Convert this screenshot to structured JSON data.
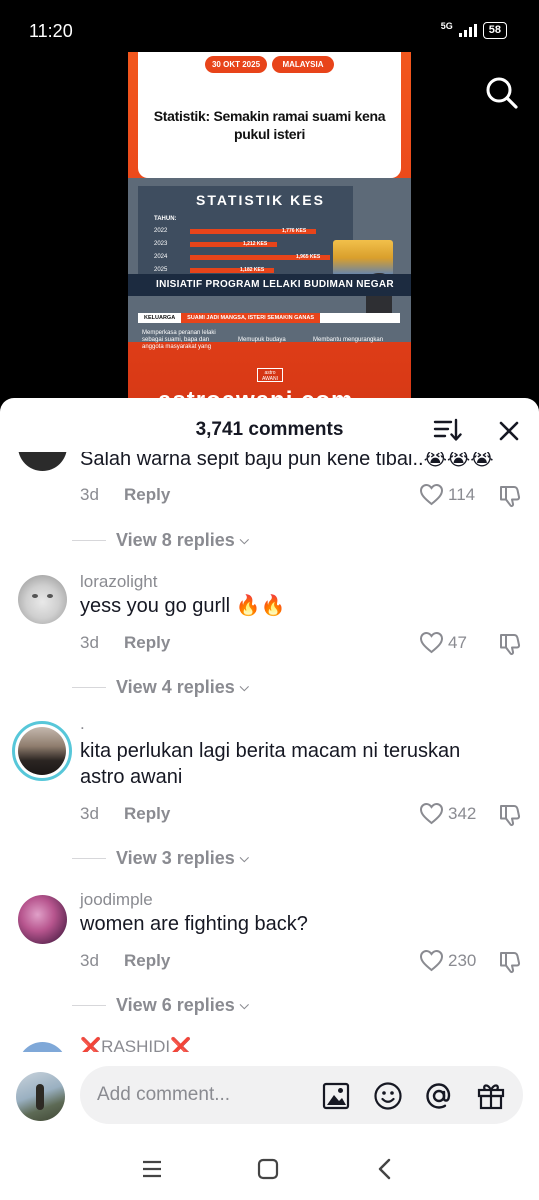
{
  "status_bar": {
    "time": "11:20",
    "network": "5G",
    "battery": "58"
  },
  "video": {
    "date_pill": "30 OKT 2025",
    "country_pill": "MALAYSIA",
    "headline": "Statistik: Semakin ramai suami kena pukul isteri",
    "board_title": "STATISTIK KES",
    "tahun_label": "TAHUN:",
    "stats": [
      {
        "year": "2022",
        "value": "1,776 KES",
        "fraction": 0.9
      },
      {
        "year": "2023",
        "value": "1,212 KES",
        "fraction": 0.62
      },
      {
        "year": "2024",
        "value": "1,965 KES",
        "fraction": 1.0
      },
      {
        "year": "2025",
        "value": "1,182 KES",
        "fraction": 0.6
      }
    ],
    "banner": "INISIATIF PROGRAM LELAKI BUDIMAN NEGAR",
    "ticker_left": "KELUARGA",
    "ticker_right": "SUAMI JADI MANGSA, ISTERI SEMAKIN GANAS",
    "lower_items": [
      "Memperkasa peranan lelaki sebagai suami, bapa dan anggota masyarakat yang",
      "Memupuk budaya",
      "Membantu mengurangkan"
    ],
    "logo_top": "astro",
    "logo_bottom": "AWANI",
    "url": "astroawani.com"
  },
  "comments_sheet": {
    "title": "3,741 comments",
    "comments": [
      {
        "username": "",
        "text": "Salah warna sepit baju pun kene tibai..😭😭😭",
        "time": "3d",
        "reply_label": "Reply",
        "likes": "114",
        "view_replies": "View 8 replies"
      },
      {
        "username": "lorazolight",
        "text": "yess you go gurll 🔥🔥",
        "time": "3d",
        "reply_label": "Reply",
        "likes": "47",
        "view_replies": "View 4 replies"
      },
      {
        "username": ".",
        "text": "kita perlukan lagi berita macam ni teruskan astro awani",
        "time": "3d",
        "reply_label": "Reply",
        "likes": "342",
        "view_replies": "View 3 replies"
      },
      {
        "username": "joodimple",
        "text": "women are fighting back?",
        "time": "3d",
        "reply_label": "Reply",
        "likes": "230",
        "view_replies": "View 6 replies"
      },
      {
        "username": "❌RASHIDI❌"
      }
    ]
  },
  "input_bar": {
    "placeholder": "Add comment..."
  },
  "colors": {
    "accent": "#e8441a",
    "muted_text": "#8a8b91",
    "primary_text": "#161823"
  }
}
